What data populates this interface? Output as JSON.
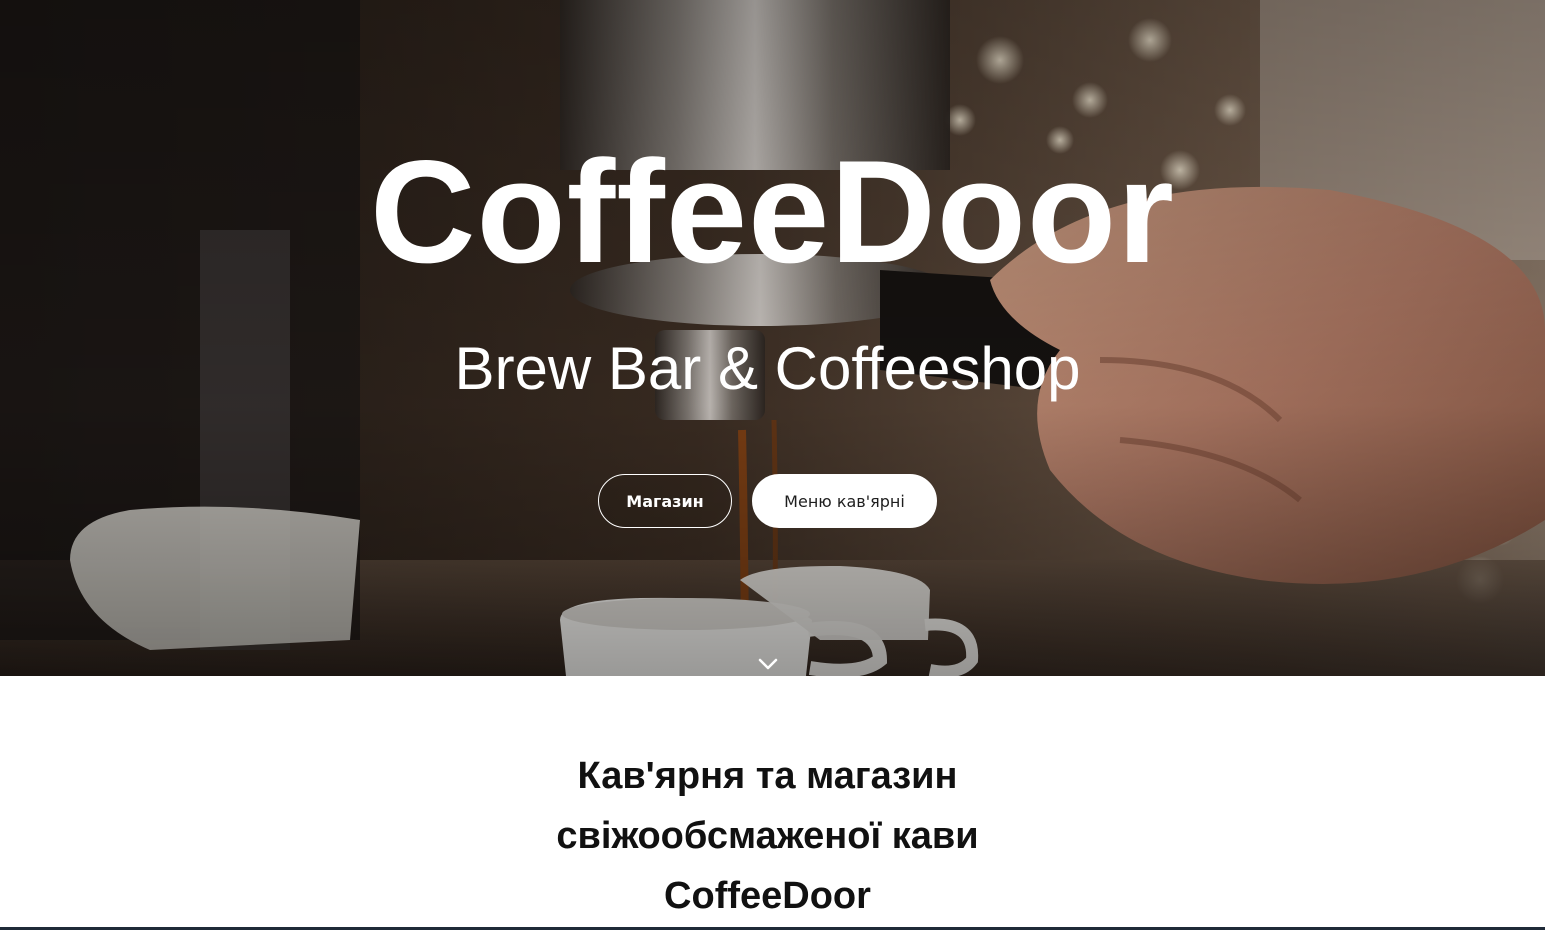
{
  "hero": {
    "title": "CoffeeDoor",
    "subtitle": "Brew Bar & Coffeeshop",
    "buttons": {
      "shop_label": "Магазин",
      "menu_label": "Меню кав'ярні"
    },
    "scroll_icon": "chevron-down-icon",
    "background_image": "espresso machine pouring into white cups, hand on portafilter"
  },
  "intro": {
    "heading_lines": [
      "Кав'ярня та магазин",
      "свіжообсмаженої кави",
      "CoffeeDoor"
    ]
  },
  "colors": {
    "text_on_hero": "#ffffff",
    "button_fill": "#ffffff",
    "heading_text": "#111111",
    "bottom_rule": "#1f2a38"
  }
}
